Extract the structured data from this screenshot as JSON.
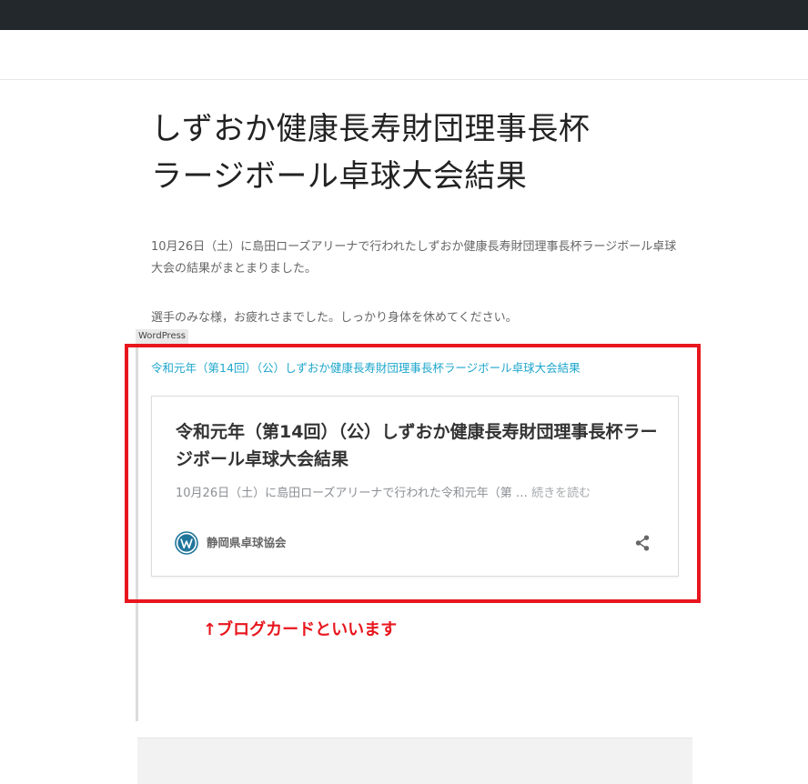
{
  "post": {
    "title_line1": "しずおか健康長寿財団理事長杯",
    "title_line2": "ラージボール卓球大会結果",
    "paragraph1": "10月26日（土）に島田ローズアリーナで行われたしずおか健康長寿財団理事長杯ラージボール卓球大会の結果がまとまりました。",
    "paragraph2": "選手のみな様，お疲れさまでした。しっかり身体を休めてください。"
  },
  "embed": {
    "label": "WordPress",
    "link_text": "令和元年（第14回）（公）しずおか健康長寿財団理事長杯ラージボール卓球大会結果",
    "card": {
      "title": "令和元年（第14回）（公）しずおか健康長寿財団理事長杯ラージボール卓球大会結果",
      "excerpt": "10月26日（土）に島田ローズアリーナで行われた令和元年（第 …",
      "read_more": "続きを読む",
      "site_name": "静岡県卓球協会",
      "site_icon": "wordpress-icon",
      "share_icon": "share-icon"
    }
  },
  "annotation": "↑ブログカードといいます",
  "colors": {
    "topbar": "#23282d",
    "link": "#1fa7cc",
    "highlight": "#e8161d",
    "wordpress_blue": "#21759b"
  }
}
